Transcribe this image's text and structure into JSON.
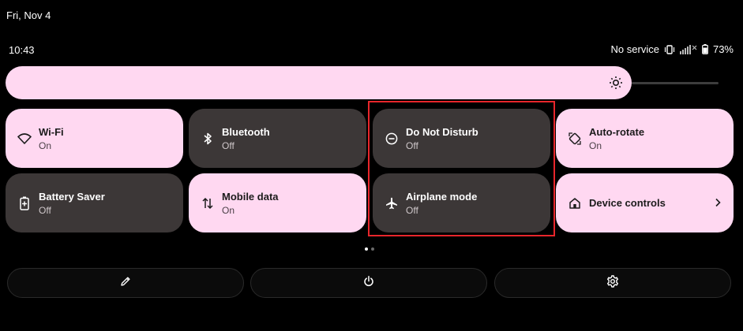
{
  "status_bar": {
    "date": "Fri, Nov 4",
    "time": "10:43",
    "service": "No service",
    "battery": "73%",
    "icons": [
      "vibrate-icon",
      "signal-icon",
      "battery-icon"
    ]
  },
  "brightness": {
    "icon": "brightness-icon",
    "level": 0.86
  },
  "tiles": [
    {
      "label": "Wi-Fi",
      "state": "On",
      "icon": "wifi-icon"
    },
    {
      "label": "Bluetooth",
      "state": "Off",
      "icon": "bluetooth-icon"
    },
    {
      "label": "Do Not Disturb",
      "state": "Off",
      "icon": "do-not-disturb-icon"
    },
    {
      "label": "Auto-rotate",
      "state": "On",
      "icon": "auto-rotate-icon"
    },
    {
      "label": "Battery Saver",
      "state": "Off",
      "icon": "battery-saver-icon"
    },
    {
      "label": "Mobile data",
      "state": "On",
      "icon": "mobile-data-icon"
    },
    {
      "label": "Airplane mode",
      "state": "Off",
      "icon": "airplane-icon"
    },
    {
      "label": "Device controls",
      "icon": "home-icon"
    }
  ],
  "pagination": {
    "current": 1,
    "total": 2
  },
  "footer": {
    "buttons": [
      "edit-icon",
      "power-icon",
      "settings-icon"
    ]
  },
  "colors": {
    "tile_on": "#ffd8f1",
    "tile_off": "#3c3737",
    "highlight": "#e8262b",
    "background": "#000000"
  }
}
